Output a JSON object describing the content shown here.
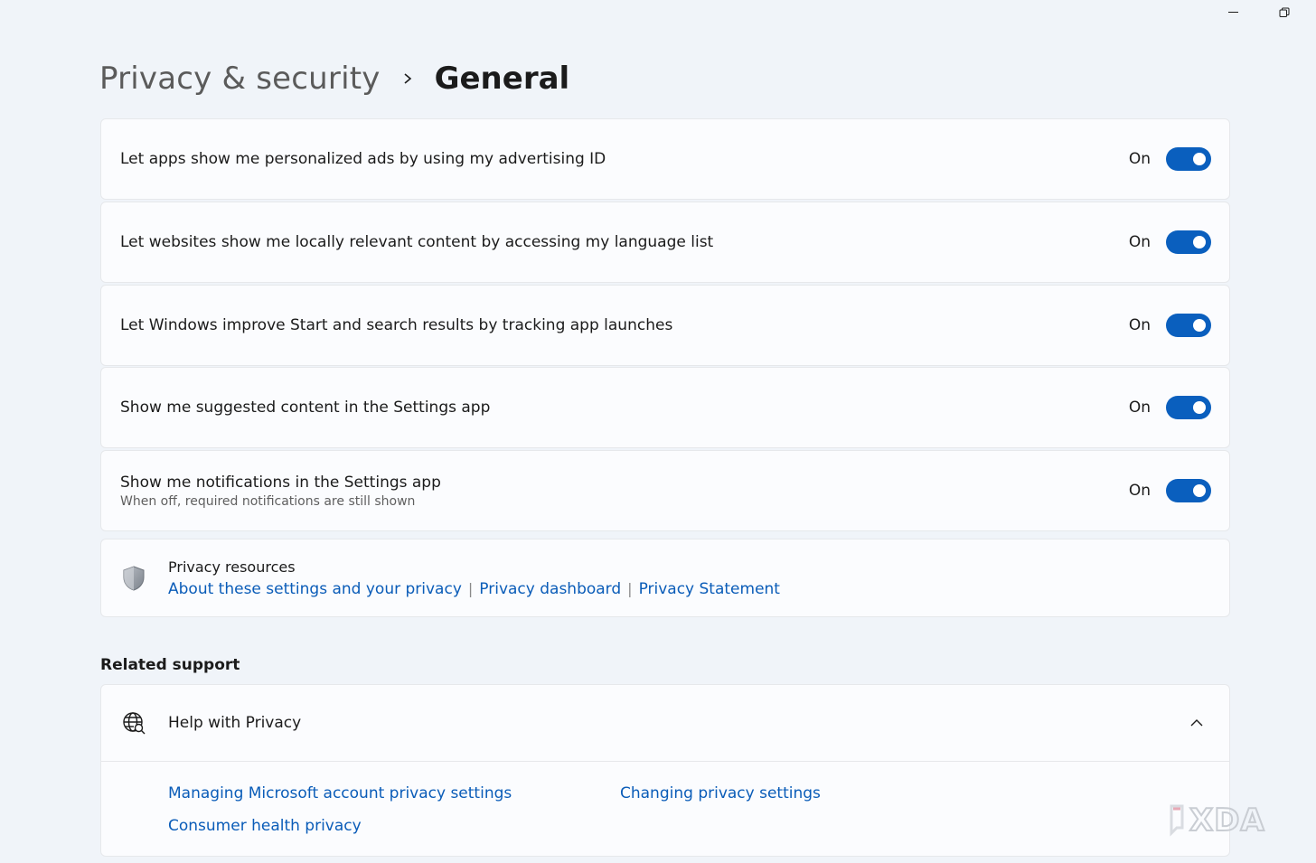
{
  "window_controls": {
    "minimize_icon": "minimize-icon",
    "restore_icon": "restore-icon"
  },
  "breadcrumb": {
    "parent": "Privacy & security",
    "current": "General"
  },
  "settings": [
    {
      "title": "Let apps show me personalized ads by using my advertising ID",
      "state": "On"
    },
    {
      "title": "Let websites show me locally relevant content by accessing my language list",
      "state": "On"
    },
    {
      "title": "Let Windows improve Start and search results by tracking app launches",
      "state": "On"
    },
    {
      "title": "Show me suggested content in the Settings app",
      "state": "On"
    },
    {
      "title": "Show me notifications in the Settings app",
      "description": "When off, required notifications are still shown",
      "state": "On"
    }
  ],
  "privacy_resources": {
    "title": "Privacy resources",
    "icon": "shield-icon",
    "links": [
      "About these settings and your privacy",
      "Privacy dashboard",
      "Privacy Statement"
    ]
  },
  "related_support": {
    "title": "Related support",
    "help": {
      "title": "Help with Privacy",
      "icon": "globe-search-icon",
      "links": [
        "Managing Microsoft account privacy settings",
        "Changing privacy settings",
        "Consumer health privacy"
      ]
    }
  },
  "watermark": "XDA",
  "colors": {
    "accent": "#0a5fbe",
    "link": "#0a5cb8",
    "background": "#f0f4f9",
    "card": "#fbfcfe"
  }
}
